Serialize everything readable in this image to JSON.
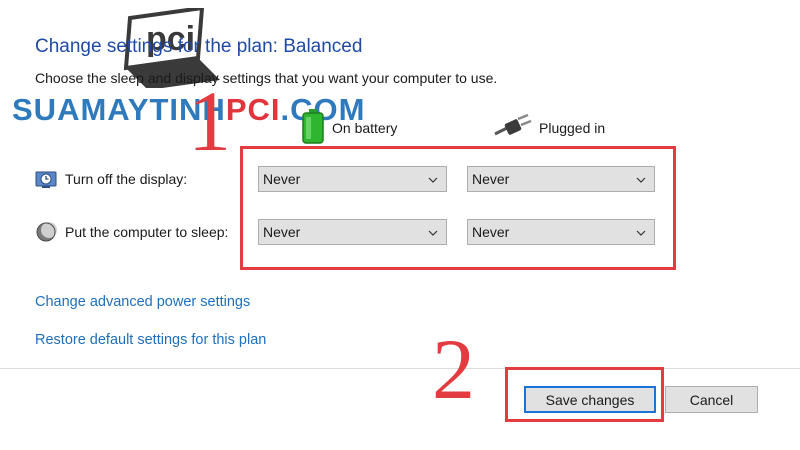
{
  "page": {
    "title": "Change settings for the plan: Balanced",
    "subtitle": "Choose the sleep and display settings that you want your computer to use."
  },
  "watermark": {
    "logo_text": "pci",
    "site_prefix": "SUAMAYTINH",
    "site_accent": "PCI",
    "site_suffix": ".COM"
  },
  "columns": {
    "battery": {
      "label": "On battery",
      "icon": "battery-icon"
    },
    "plugged": {
      "label": "Plugged in",
      "icon": "plug-icon"
    }
  },
  "rows": [
    {
      "label": "Turn off the display:",
      "icon": "display-clock-icon",
      "battery_value": "Never",
      "plugged_value": "Never"
    },
    {
      "label": "Put the computer to sleep:",
      "icon": "sleep-moon-icon",
      "battery_value": "Never",
      "plugged_value": "Never"
    }
  ],
  "links": {
    "advanced": "Change advanced power settings",
    "restore": "Restore default settings for this plan"
  },
  "buttons": {
    "save": "Save changes",
    "cancel": "Cancel"
  },
  "annotations": {
    "step1": "1",
    "step2": "2",
    "color": "#e23b40"
  },
  "colors": {
    "title": "#1f4aa5",
    "link": "#1e6fbd",
    "select_bg": "#e1e1e1",
    "focus_border": "#1a73d9"
  }
}
